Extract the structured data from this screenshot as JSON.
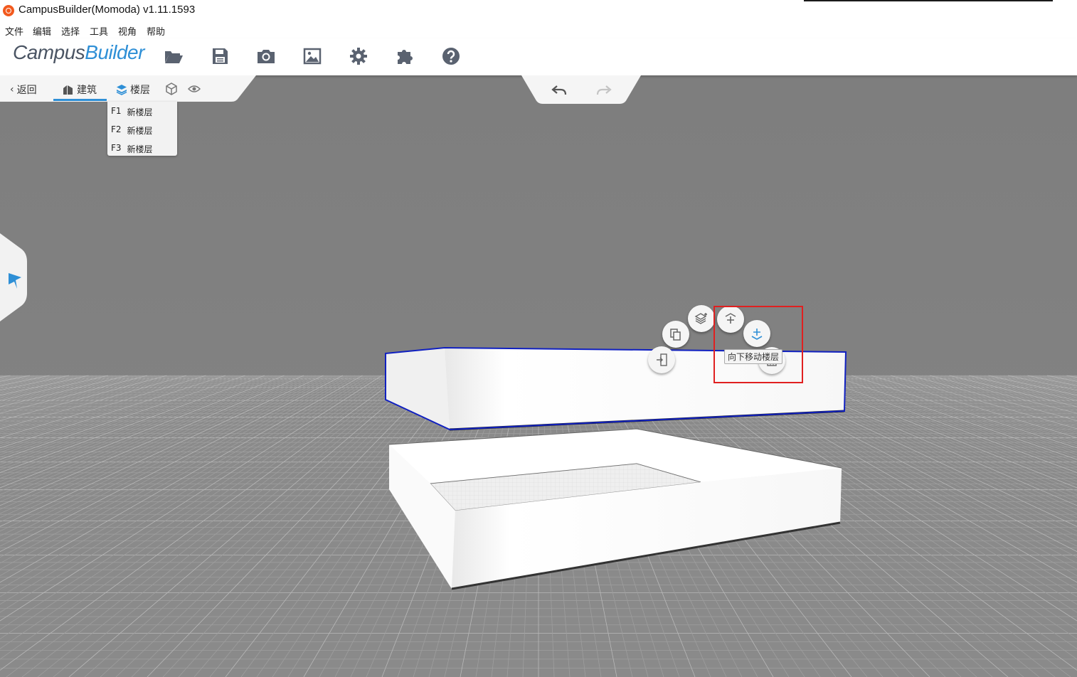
{
  "window": {
    "title": "CampusBuilder(Momoda) v1.11.1593"
  },
  "menu": [
    "文件",
    "编辑",
    "选择",
    "工具",
    "视角",
    "帮助"
  ],
  "brand": {
    "part1": "Campus",
    "part2": "Builder"
  },
  "toolbar_icons": [
    "folder-open-icon",
    "save-icon",
    "camera-icon",
    "image-icon",
    "gear-icon",
    "plugin-icon",
    "help-icon"
  ],
  "subtabs": {
    "back": "返回",
    "building": "建筑",
    "floor": "楼层"
  },
  "floors": [
    {
      "id": "F1",
      "name": "新楼层"
    },
    {
      "id": "F2",
      "name": "新楼层"
    },
    {
      "id": "F3",
      "name": "新楼层"
    }
  ],
  "tooltip": "向下移动楼层",
  "colors": {
    "accent": "#2e8fd6",
    "selection": "#1020c0",
    "highlight": "#e02020"
  }
}
